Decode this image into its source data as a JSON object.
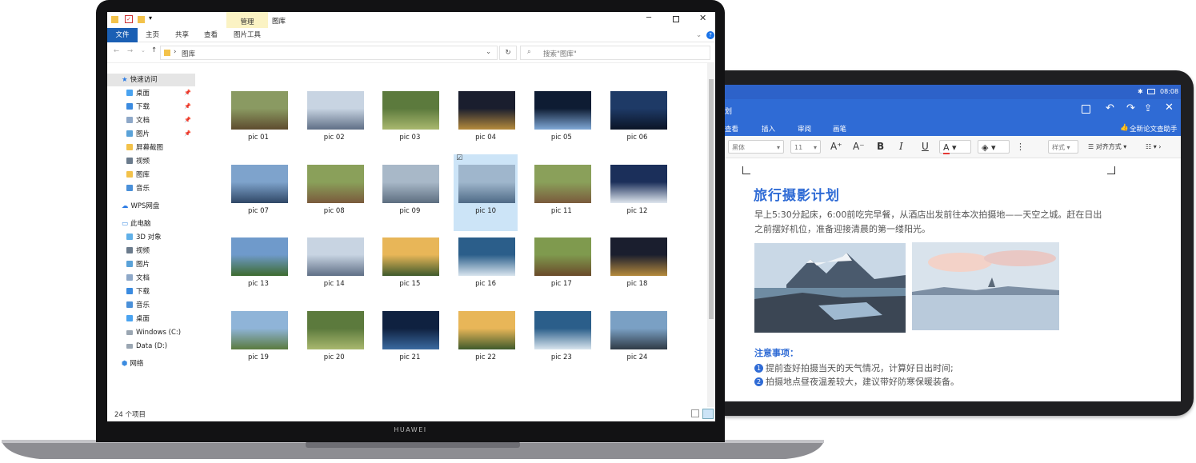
{
  "laptop": {
    "brand": "HUAWEI",
    "explorer": {
      "window_title": "图库",
      "context_tab": "管理",
      "ribbon_tabs": [
        "文件",
        "主页",
        "共享",
        "查看",
        "图片工具"
      ],
      "address": "图库",
      "search_placeholder": "搜索\"图库\"",
      "nav": [
        {
          "label": "快速访问",
          "type": "header"
        },
        {
          "label": "桌面",
          "pinned": true
        },
        {
          "label": "下载",
          "pinned": true
        },
        {
          "label": "文档",
          "pinned": true
        },
        {
          "label": "图片",
          "pinned": true
        },
        {
          "label": "屏幕截图"
        },
        {
          "label": "视频"
        },
        {
          "label": "图库"
        },
        {
          "label": "音乐"
        },
        {
          "label": "WPS网盘",
          "type": "header"
        },
        {
          "label": "此电脑",
          "type": "header"
        },
        {
          "label": "3D 对象"
        },
        {
          "label": "视频"
        },
        {
          "label": "图片"
        },
        {
          "label": "文档"
        },
        {
          "label": "下载"
        },
        {
          "label": "音乐"
        },
        {
          "label": "桌面"
        },
        {
          "label": "Windows (C:)"
        },
        {
          "label": "Data (D:)"
        },
        {
          "label": "网络",
          "type": "header"
        }
      ],
      "files": [
        "pic 01",
        "pic 02",
        "pic 03",
        "pic 04",
        "pic 05",
        "pic 06",
        "pic 07",
        "pic 08",
        "pic 09",
        "pic 10",
        "pic 11",
        "pic 12",
        "pic 13",
        "pic 14",
        "pic 15",
        "pic 16",
        "pic 17",
        "pic 18",
        "pic 19",
        "pic 20",
        "pic 21",
        "pic 22",
        "pic 23",
        "pic 24"
      ],
      "selected_file": "pic 10",
      "status": "24 个项目"
    }
  },
  "tablet": {
    "status_time": "08:08",
    "menu_tabs": [
      "查看",
      "插入",
      "审阅",
      "画笔"
    ],
    "assistant": "全新论文查助手",
    "toolbar": {
      "font": "黑体",
      "size": "11",
      "style": "样式",
      "align": "对齐方式"
    },
    "doc": {
      "title": "旅行摄影计划",
      "paragraph": "早上5:30分起床，6:00前吃完早餐，从酒店出发前往本次拍摄地——天空之城。赶在日出之前摆好机位，准备迎接清晨的第一缕阳光。",
      "note_title": "注意事项：",
      "notes": [
        "提前查好拍摄当天的天气情况，计算好日出时间;",
        "拍摄地点昼夜温差较大，建议带好防寒保暖装备。"
      ]
    }
  },
  "colors": {
    "wps_blue": "#2f6bd5",
    "win_blue": "#1a5fb4",
    "selection": "#cce4f7"
  }
}
